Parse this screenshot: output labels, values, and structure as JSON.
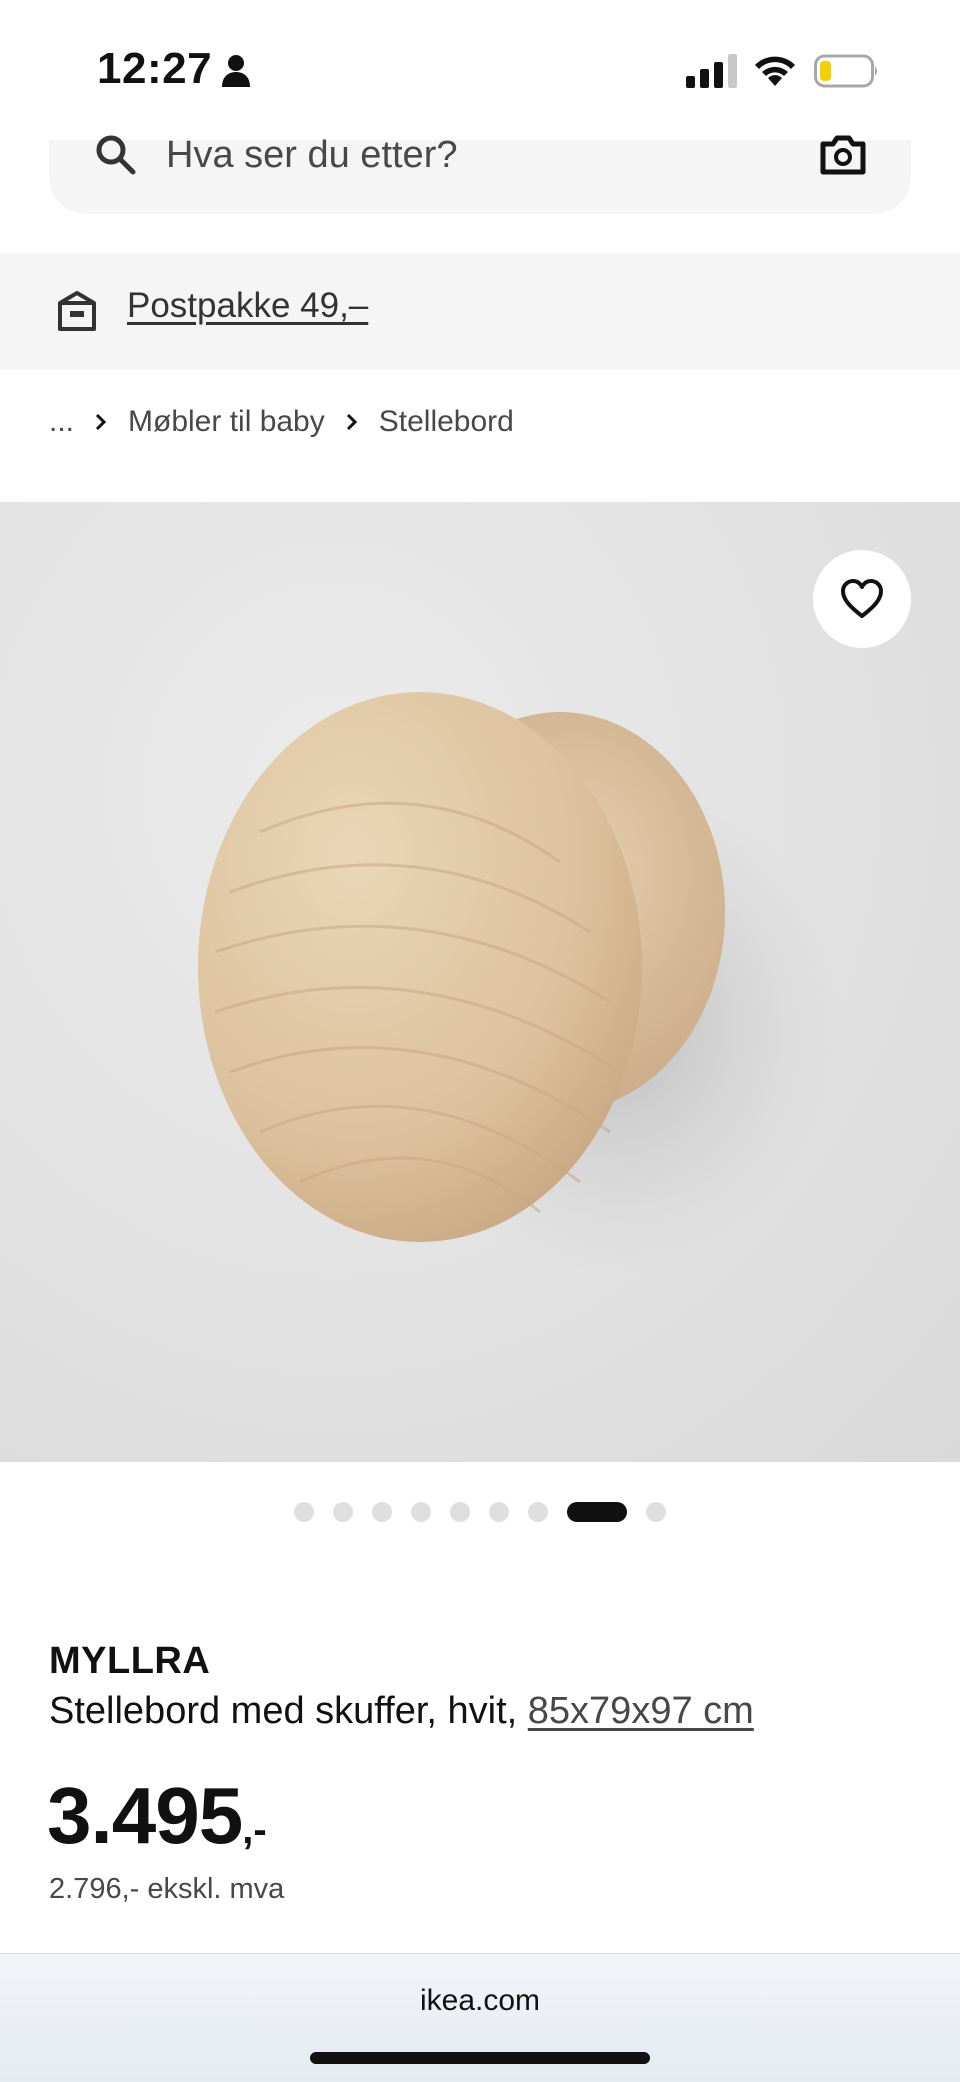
{
  "status_bar": {
    "time": "12:27",
    "icons": [
      "person-icon",
      "signal-icon",
      "wifi-icon",
      "battery-icon"
    ],
    "battery_color": "#f5d000"
  },
  "search": {
    "placeholder": "Hva ser du etter?",
    "icons": [
      "search-icon",
      "camera-icon"
    ]
  },
  "promo": {
    "icon": "box-icon",
    "label": "Postpakke 49,–"
  },
  "breadcrumb": {
    "items": [
      "...",
      "Møbler til baby",
      "Stellebord"
    ]
  },
  "product_image": {
    "favorite_icon": "heart-icon"
  },
  "carousel": {
    "count": 9,
    "active_index": 7
  },
  "product": {
    "name": "MYLLRA",
    "description": "Stellebord med skuffer, hvit,",
    "size": "85x79x97 cm",
    "price": "3.495",
    "price_suffix": ",-",
    "price_ex_vat": "2.796,- ekskl. mva"
  },
  "browser": {
    "domain": "ikea.com"
  },
  "colors": {
    "text": "#111111",
    "muted": "#484848",
    "surface": "#f5f5f5"
  }
}
